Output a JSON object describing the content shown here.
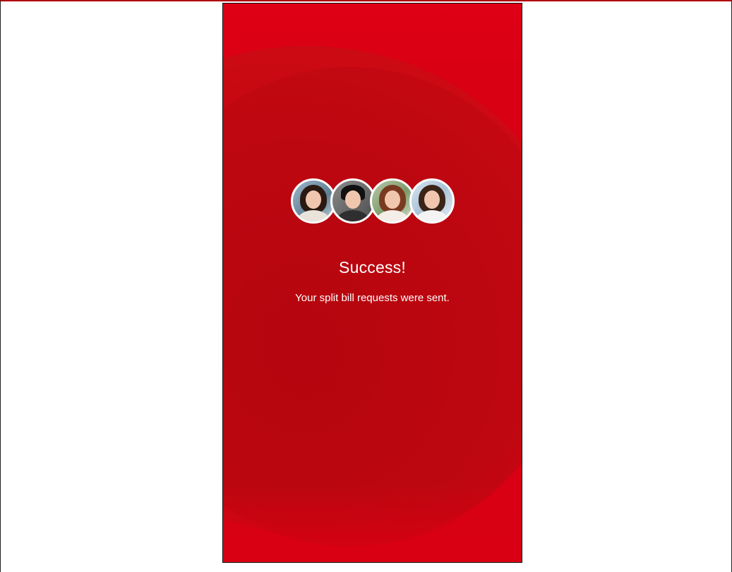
{
  "screen": {
    "title": "Success!",
    "message": "Your split bill requests were sent."
  },
  "avatars": [
    {
      "name": "avatar-1"
    },
    {
      "name": "avatar-2"
    },
    {
      "name": "avatar-3"
    },
    {
      "name": "avatar-4"
    }
  ],
  "colors": {
    "background_red": "#d90014",
    "dark_red": "#b80410",
    "text": "#ffffff"
  }
}
